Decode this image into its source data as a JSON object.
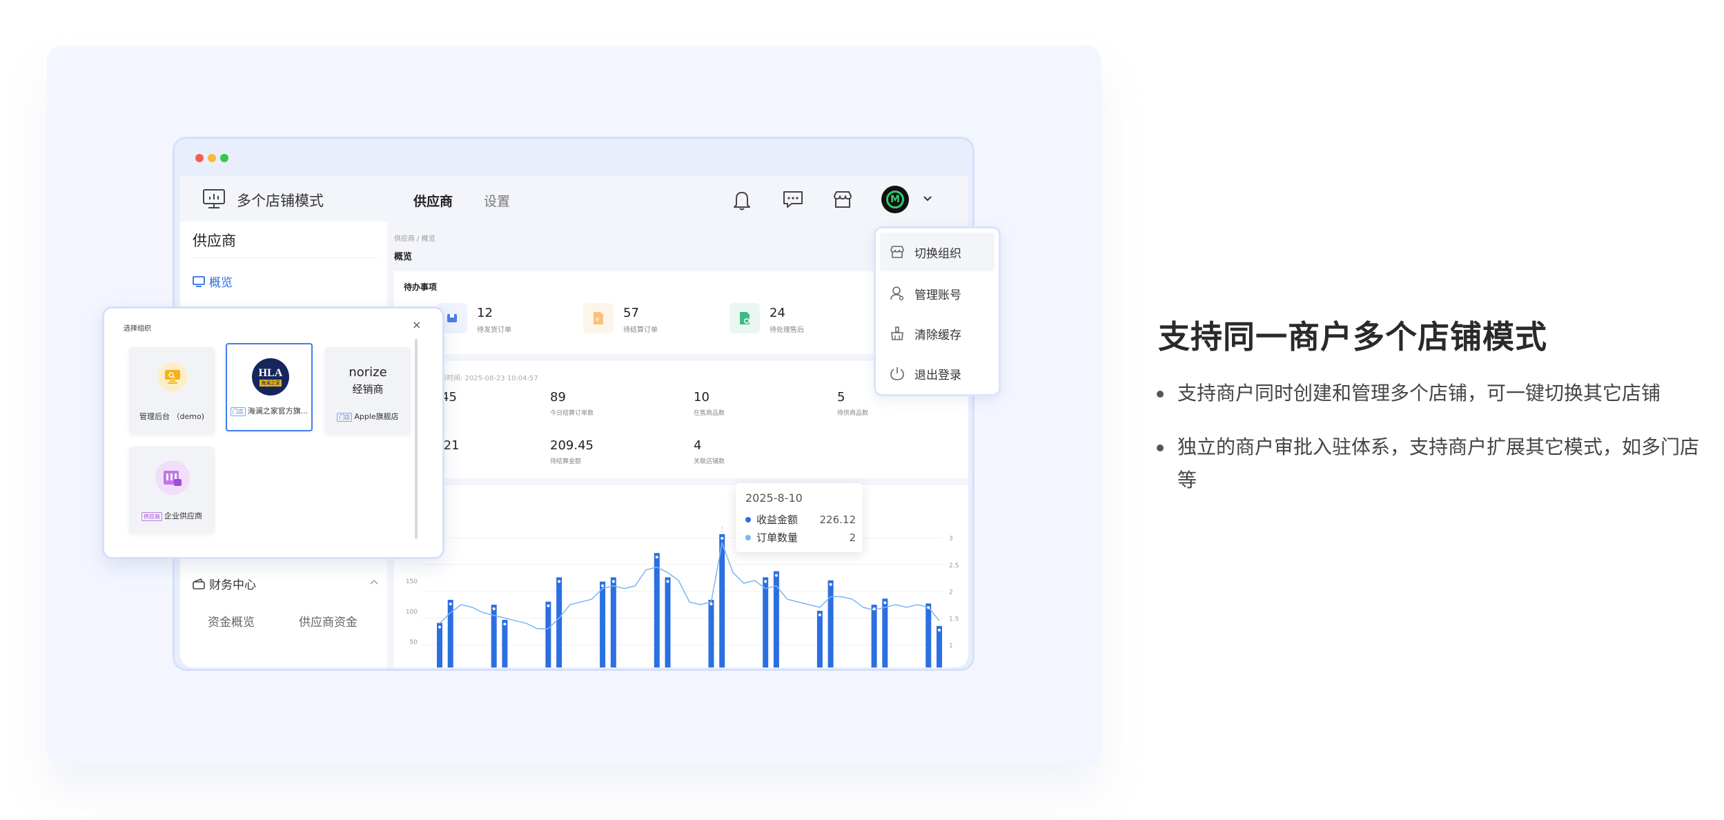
{
  "app": {
    "title": "多个店铺模式",
    "nav": [
      "供应商",
      "设置"
    ]
  },
  "sidebar": {
    "section_title": "供应商",
    "overview": "概览",
    "finance": "财务中心",
    "finance_items": [
      "资金概览",
      "供应商资金"
    ]
  },
  "main": {
    "breadcrumb": "供应商 / 概览",
    "page_title": "概览",
    "todo_title": "待办事项",
    "todos": [
      {
        "value": "12",
        "label": "待发货订单"
      },
      {
        "value": "57",
        "label": "待结算订单"
      },
      {
        "value": "24",
        "label": "待处理售后"
      }
    ],
    "update_text": "新时间: 2025-08-23 10:04:57",
    "stats_row1": [
      {
        "value": "45",
        "label": ""
      },
      {
        "value": "89",
        "label": "今日结算订单数"
      },
      {
        "value": "10",
        "label": "在售商品数"
      },
      {
        "value": "5",
        "label": "待供商品数"
      }
    ],
    "stats_row2": [
      {
        "value": ".21",
        "label": ""
      },
      {
        "value": "209.45",
        "label": "待结算金额"
      },
      {
        "value": "4",
        "label": "关联店铺数"
      }
    ]
  },
  "tooltip": {
    "date": "2025-8-10",
    "rows": [
      {
        "label": "收益金额",
        "value": "226.12",
        "color": "#2b6fe0"
      },
      {
        "label": "订单数量",
        "value": "2",
        "color": "#7bb5f2"
      }
    ]
  },
  "menu": {
    "items": [
      "切换组织",
      "管理账号",
      "清除缓存",
      "退出登录"
    ]
  },
  "org_dialog": {
    "title": "选择组织",
    "close": "×",
    "cards": [
      {
        "label": "管理后台 （demo)",
        "tag": ""
      },
      {
        "label": "海澜之家官方旗...",
        "tag": "门店",
        "logo_text": "HLA",
        "logo_sub": "海澜之家"
      },
      {
        "label": "Apple旗舰店",
        "tag": "门店",
        "logo_text": "norize",
        "logo_sub": "经销商"
      },
      {
        "label": "企业供应商",
        "tag": "供应商"
      }
    ]
  },
  "feature": {
    "title": "支持同一商户多个店铺模式",
    "bullets": [
      "支持商户同时创建和管理多个店铺，可一键切换其它店铺",
      "独立的商户审批入驻体系，支持商户扩展其它模式，如多门店等"
    ]
  },
  "chart_data": {
    "type": "bar",
    "left_ticks": [
      "150",
      "100",
      "50"
    ],
    "right_ticks": [
      "3",
      "2.5",
      "2",
      "1.5",
      "1"
    ],
    "bar_color": "#2b6fe0",
    "line_color": "#7bb5f2",
    "values": [
      80,
      118,
      0,
      0,
      0,
      110,
      85,
      0,
      0,
      0,
      115,
      155,
      0,
      0,
      0,
      148,
      155,
      0,
      0,
      0,
      195,
      155,
      0,
      0,
      0,
      118,
      226,
      0,
      0,
      0,
      155,
      165,
      0,
      0,
      0,
      100,
      150,
      0,
      0,
      0,
      110,
      120,
      0,
      0,
      0,
      112,
      75
    ],
    "line": [
      1.4,
      1.6,
      1.75,
      1.7,
      1.6,
      1.55,
      1.5,
      1.45,
      1.4,
      1.3,
      1.3,
      1.5,
      1.75,
      1.8,
      1.85,
      2.05,
      2.1,
      2.05,
      2.1,
      2.4,
      2.45,
      2.35,
      2.2,
      1.8,
      1.75,
      1.8,
      2.9,
      2.35,
      2.15,
      2.2,
      2.05,
      2.1,
      1.85,
      1.8,
      1.75,
      1.7,
      1.9,
      1.9,
      1.85,
      1.7,
      1.65,
      1.7,
      1.75,
      1.7,
      1.75,
      1.7,
      1.45
    ]
  }
}
